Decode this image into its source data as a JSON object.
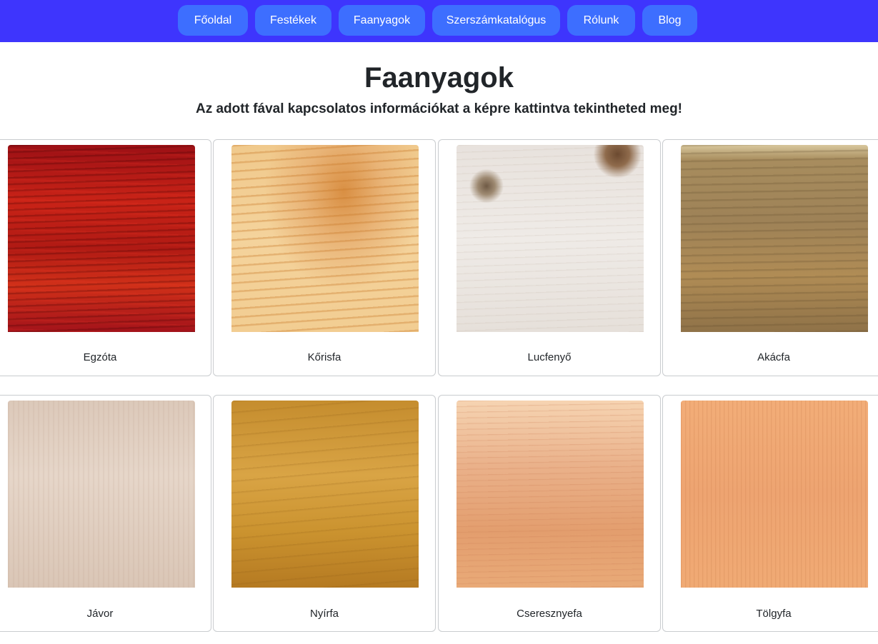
{
  "nav": {
    "items": [
      {
        "label": "Főoldal"
      },
      {
        "label": "Festékek"
      },
      {
        "label": "Faanyagok"
      },
      {
        "label": "Szerszámkatalógus"
      },
      {
        "label": "Rólunk"
      },
      {
        "label": "Blog"
      }
    ]
  },
  "header": {
    "title": "Faanyagok",
    "subtitle": "Az adott fával kapcsolatos információkat a képre kattintva tekintheted meg!"
  },
  "woods": [
    {
      "label": "Egzóta"
    },
    {
      "label": "Kőrisfa"
    },
    {
      "label": "Lucfenyő"
    },
    {
      "label": "Akácfa"
    },
    {
      "label": "Jávor"
    },
    {
      "label": "Nyírfa"
    },
    {
      "label": "Cseresznyefa"
    },
    {
      "label": "Tölgyfa"
    }
  ],
  "colors": {
    "navbar_bg": "#3e35fd",
    "nav_button_bg": "#3d6eff"
  }
}
